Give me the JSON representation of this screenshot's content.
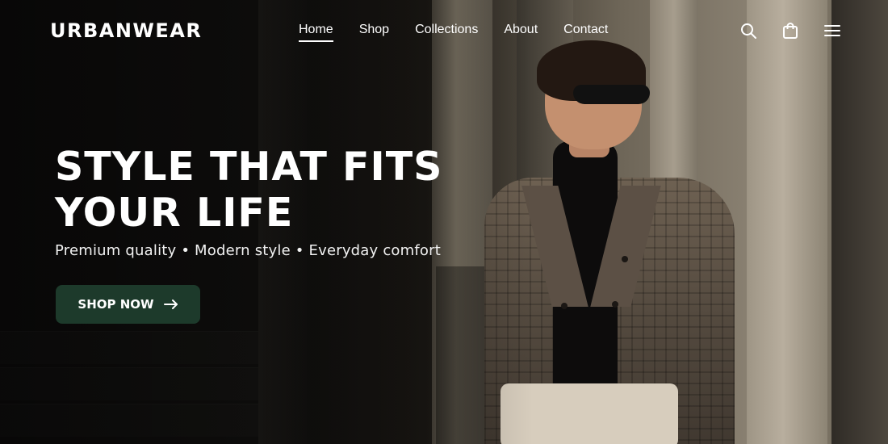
{
  "brand": {
    "name": "URBANWEAR"
  },
  "nav": {
    "items": [
      {
        "label": "Home",
        "active": true
      },
      {
        "label": "Shop",
        "active": false
      },
      {
        "label": "Collections",
        "active": false
      },
      {
        "label": "About",
        "active": false
      },
      {
        "label": "Contact",
        "active": false
      }
    ]
  },
  "header_icons": [
    "search-icon",
    "shopping-bag-icon",
    "menu-icon"
  ],
  "hero": {
    "headline_line1": "STYLE THAT FITS",
    "headline_line2": "YOUR LIFE",
    "tagline": "Premium quality • Modern style • Everyday comfort",
    "cta_label": "SHOP NOW",
    "cta_icon": "arrow-right-icon"
  },
  "colors": {
    "cta_background": "#1d3a2b",
    "text": "#ffffff"
  }
}
